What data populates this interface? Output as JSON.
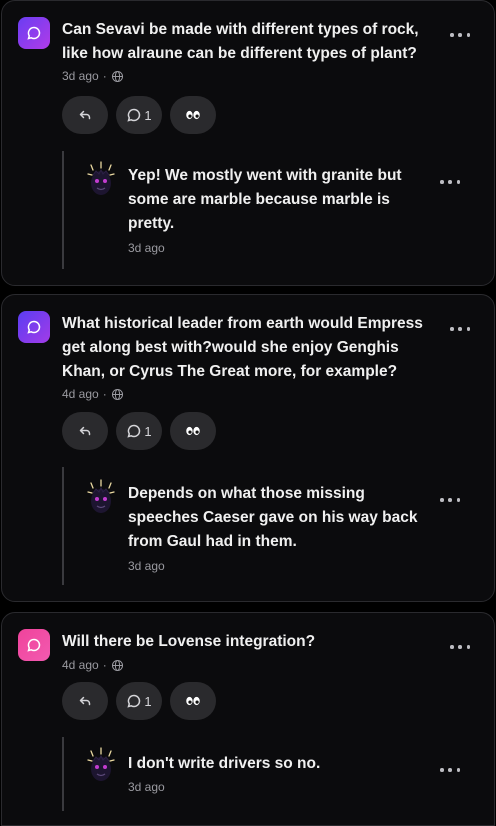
{
  "posts": [
    {
      "icon_color": "#8b3cf0",
      "question": "Can Sevavi be made with different types of rock, like how alraune can be different types of plant?",
      "time": "3d ago",
      "separator": "·",
      "reply_count": "1",
      "reply": {
        "text": "Yep! We mostly went with granite but some are marble because marble is pretty.",
        "time": "3d ago"
      }
    },
    {
      "icon_color": "#7b3cf0",
      "question": "What historical leader from earth would Empress get along best with?would she enjoy Genghis Khan, or Cyrus The Great more, for example?",
      "time": "4d ago",
      "separator": "·",
      "reply_count": "1",
      "reply": {
        "text": "Depends on what those missing speeches Caeser gave on his way back from Gaul had in them.",
        "time": "3d ago"
      }
    },
    {
      "icon_color": "#f0439b",
      "question": "Will there be Lovense integration?",
      "time": "4d ago",
      "separator": "·",
      "reply_count": "1",
      "reply": {
        "text": "I don't write drivers so no.",
        "time": "3d ago"
      }
    }
  ]
}
